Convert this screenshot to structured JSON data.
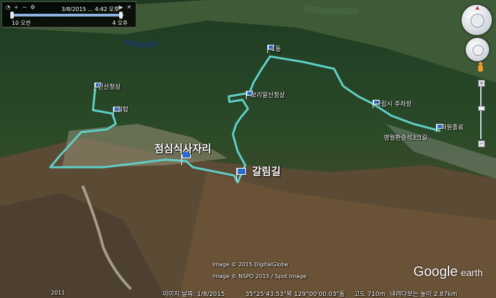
{
  "time_slider": {
    "date_time": "3/8/2015 ... 4:42 오후",
    "start_label": "10 오전",
    "end_label": "4 오후"
  },
  "placemarks": {
    "p1": "인산정상",
    "p2": "철탑",
    "p3": "점심식사자리",
    "p4": "갈림길",
    "p5": "보리알산정상",
    "p6": "1동",
    "p7": "국립시 주차장",
    "p8": "화원종료",
    "p9": "영월환승석3크길"
  },
  "credits": {
    "digitalglobe": "Image © 2015 DigitalGlobe",
    "nspo": "Image © NSPO 2015 / Spot Image",
    "logo_google": "Google",
    "logo_earth": "earth",
    "year": "2011"
  },
  "status_bar": {
    "date": "이미지 날짜: 1/8/2015",
    "coords": "35°25'43.53\"북 129°00'00.03\"동",
    "elevation": "고도 710m",
    "eye_alt": "내려다보는 높이 2.87km"
  }
}
